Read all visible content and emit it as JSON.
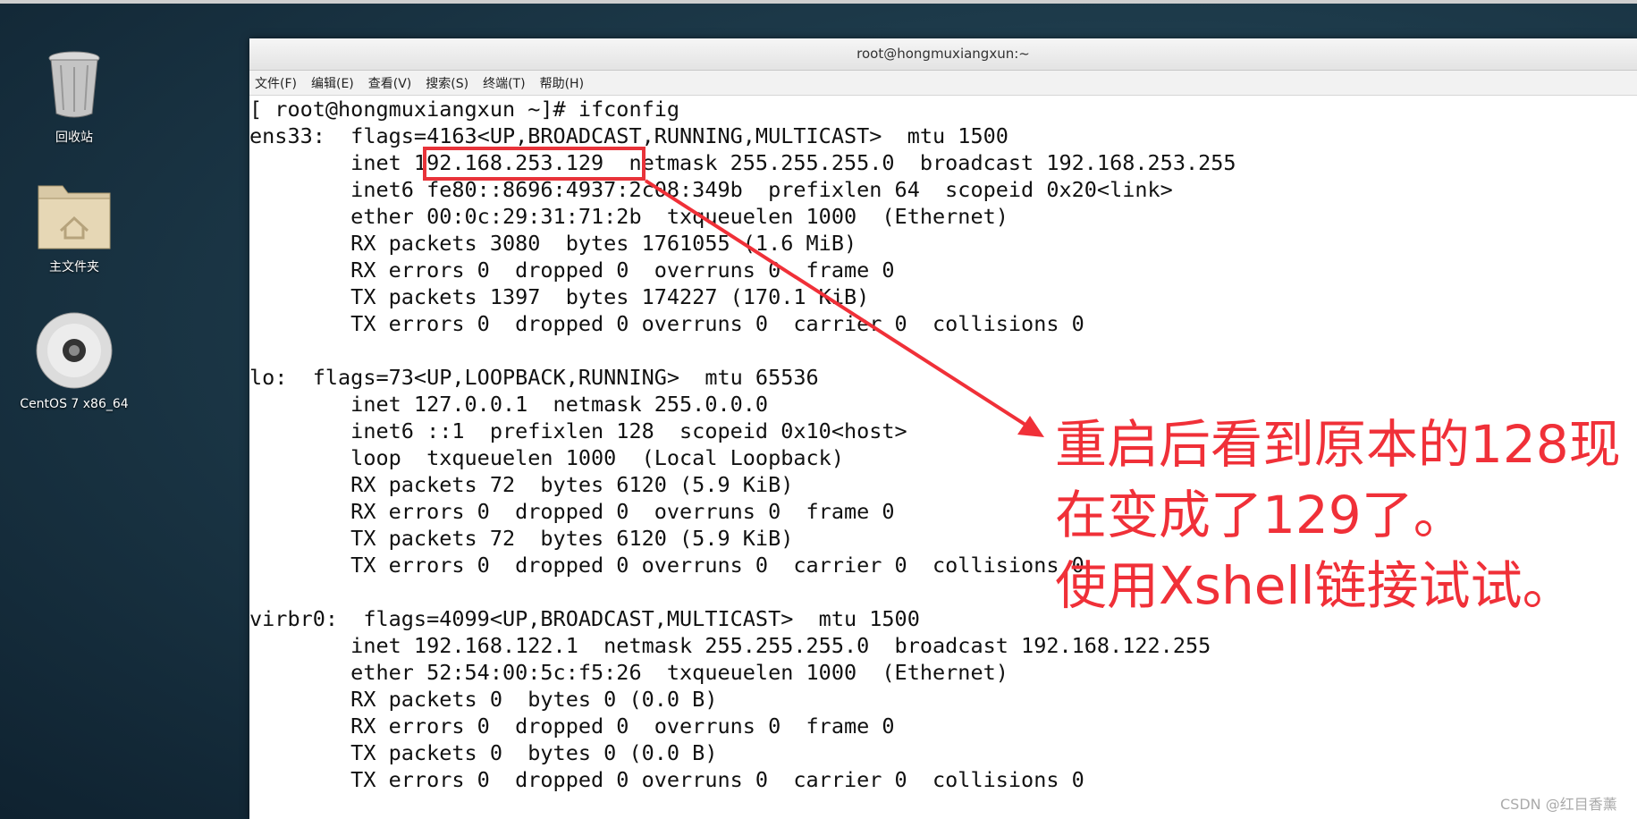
{
  "desktop": {
    "icons": [
      {
        "label": "回收站",
        "icon": "trash-icon"
      },
      {
        "label": "主文件夹",
        "icon": "home-folder-icon"
      },
      {
        "label": "CentOS 7 x86_64",
        "icon": "disc-icon"
      }
    ]
  },
  "window": {
    "title": "root@hongmuxiangxun:~",
    "menu": [
      "文件(F)",
      "编辑(E)",
      "查看(V)",
      "搜索(S)",
      "终端(T)",
      "帮助(H)"
    ]
  },
  "terminal": {
    "lines": [
      "[ root@hongmuxiangxun ~]# ifconfig",
      "ens33:  flags=4163<UP,BROADCAST,RUNNING,MULTICAST>  mtu 1500",
      "        inet 192.168.253.129  netmask 255.255.255.0  broadcast 192.168.253.255",
      "        inet6 fe80::8696:4937:2c08:349b  prefixlen 64  scopeid 0x20<link>",
      "        ether 00:0c:29:31:71:2b  txqueuelen 1000  (Ethernet)",
      "        RX packets 3080  bytes 1761055 (1.6 MiB)",
      "        RX errors 0  dropped 0  overruns 0  frame 0",
      "        TX packets 1397  bytes 174227 (170.1 KiB)",
      "        TX errors 0  dropped 0 overruns 0  carrier 0  collisions 0",
      "",
      "lo:  flags=73<UP,LOOPBACK,RUNNING>  mtu 65536",
      "        inet 127.0.0.1  netmask 255.0.0.0",
      "        inet6 ::1  prefixlen 128  scopeid 0x10<host>",
      "        loop  txqueuelen 1000  (Local Loopback)",
      "        RX packets 72  bytes 6120 (5.9 KiB)",
      "        RX errors 0  dropped 0  overruns 0  frame 0",
      "        TX packets 72  bytes 6120 (5.9 KiB)",
      "        TX errors 0  dropped 0 overruns 0  carrier 0  collisions 0",
      "",
      "virbr0:  flags=4099<UP,BROADCAST,MULTICAST>  mtu 1500",
      "        inet 192.168.122.1  netmask 255.255.255.0  broadcast 192.168.122.255",
      "        ether 52:54:00:5c:f5:26  txqueuelen 1000  (Ethernet)",
      "        RX packets 0  bytes 0 (0.0 B)",
      "        RX errors 0  dropped 0  overruns 0  frame 0",
      "        TX packets 0  bytes 0 (0.0 B)",
      "        TX errors 0  dropped 0 overruns 0  carrier 0  collisions 0"
    ]
  },
  "annotation": {
    "lines": [
      "重启后看到原本的128现",
      "在变成了129了。",
      "使用Xshell链接试试。"
    ],
    "color": "#f03038"
  },
  "watermark": "CSDN @红目香薰"
}
